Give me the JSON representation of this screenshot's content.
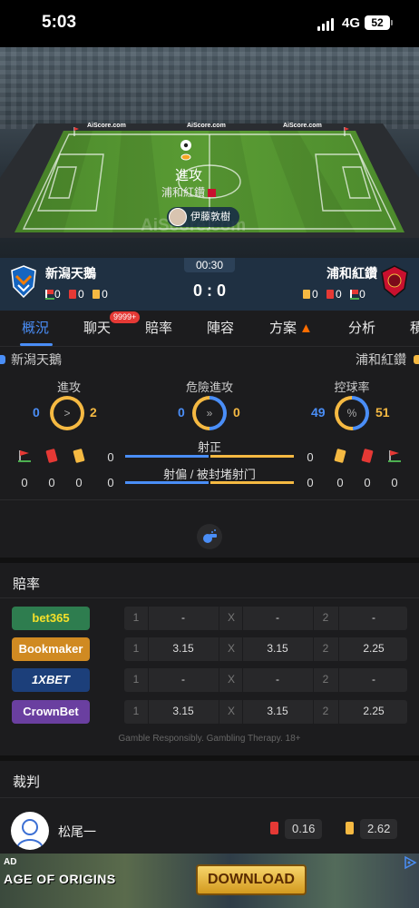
{
  "status_bar": {
    "time": "5:03",
    "network": "4G",
    "battery": "52"
  },
  "pitch": {
    "board_text": "AiScore.com",
    "watermark": "AiScore.com",
    "event_title": "進攻",
    "event_team": "浦和紅鑽",
    "player_name": "伊藤敦樹"
  },
  "match": {
    "timer": "00:30",
    "home_name": "新潟天鵝",
    "away_name": "浦和紅鑽",
    "score": "0 : 0",
    "home_mini": {
      "corners": "0",
      "red": "0",
      "yellow": "0"
    },
    "away_mini": {
      "yellow": "0",
      "red": "0",
      "corners": "0"
    }
  },
  "tabs": [
    {
      "label": "概況"
    },
    {
      "label": "聊天"
    },
    {
      "label": "賠率"
    },
    {
      "label": "陣容"
    },
    {
      "label": "方案"
    },
    {
      "label": "分析"
    },
    {
      "label": "積"
    }
  ],
  "chat_badge": "9999+",
  "stats": {
    "home_team": "新潟天鵝",
    "away_team": "浦和紅鑽",
    "attack": {
      "label": "進攻",
      "home": "0",
      "away": "2",
      "home_fraction": 0.0
    },
    "dangerous": {
      "label": "危險進攻",
      "home": "0",
      "away": "0",
      "home_fraction": 0.5
    },
    "possession": {
      "label": "控球率",
      "home": "49",
      "away": "51",
      "home_fraction": 0.49
    },
    "on_target": {
      "label": "射正",
      "home": "0",
      "away": "0"
    },
    "off_target": {
      "label": "射偏 / 被封堵射门",
      "home": "0",
      "away": "0"
    },
    "home_corners": "0",
    "home_red": "0",
    "home_yellow": "0",
    "away_corners": "0",
    "away_red": "0",
    "away_yellow": "0"
  },
  "odds": {
    "title": "賠率",
    "rows": [
      {
        "book": "bet365",
        "bg": "#2e7d4f",
        "fg": "#f5e02a",
        "c1": "1",
        "v1": "-",
        "cx": "X",
        "vx": "-",
        "c2": "2",
        "v2": "-"
      },
      {
        "book": "Bookmaker",
        "bg": "#d08a22",
        "fg": "#ffffff",
        "c1": "1",
        "v1": "3.15",
        "cx": "X",
        "vx": "3.15",
        "c2": "2",
        "v2": "2.25"
      },
      {
        "book": "1XBET",
        "bg": "#1c3f7a",
        "fg": "#ffffff",
        "c1": "1",
        "v1": "-",
        "cx": "X",
        "vx": "-",
        "c2": "2",
        "v2": "-"
      },
      {
        "book": "CrownBet",
        "bg": "#6a3fa0",
        "fg": "#ffffff",
        "c1": "1",
        "v1": "3.15",
        "cx": "X",
        "vx": "3.15",
        "c2": "2",
        "v2": "2.25"
      }
    ],
    "disclaimer": "Gamble Responsibly. Gambling Therapy. 18+"
  },
  "referee": {
    "title": "裁判",
    "name": "松尾一",
    "red_avg": "0.16",
    "yellow_avg": "2.62"
  },
  "ad": {
    "tag": "AD",
    "game": "AGE OF ORIGINS",
    "button": "DOWNLOAD"
  },
  "colors": {
    "home": "#4a8ef7",
    "away": "#f5b942",
    "accent": "#4a8ef7"
  }
}
